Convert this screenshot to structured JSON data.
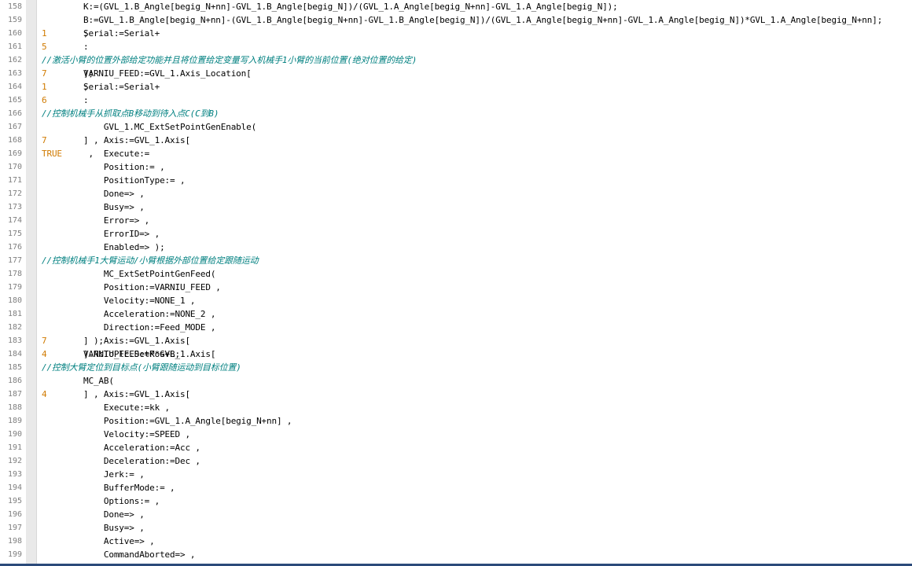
{
  "editor": {
    "lines": [
      {
        "n": "158",
        "segs": [
          {
            "t": "K:=(GVL_1.B_Angle[begig_N+nn]-GVL_1.B_Angle[begig_N])/(GVL_1.A_Angle[begig_N+nn]-GVL_1.A_Angle[begig_N]);",
            "k": "code"
          }
        ]
      },
      {
        "n": "159",
        "segs": [
          {
            "t": "B:=GVL_1.B_Angle[begig_N+nn]-(GVL_1.B_Angle[begig_N+nn]-GVL_1.B_Angle[begig_N])/(GVL_1.A_Angle[begig_N+nn]-GVL_1.A_Angle[begig_N])*GVL_1.A_Angle[begig_N+nn];",
            "k": "code"
          }
        ]
      },
      {
        "n": "160",
        "segs": [
          {
            "t": "Serial:=Serial+",
            "k": "code"
          },
          {
            "t": "1",
            "k": "num"
          },
          {
            "t": ";",
            "k": "code"
          }
        ]
      },
      {
        "n": "161",
        "segs": [
          {
            "t": "5",
            "k": "num"
          },
          {
            "t": ":",
            "k": "code"
          }
        ]
      },
      {
        "n": "162",
        "segs": [
          {
            "t": "//激活小臂的位置外部给定功能并且将位置给定变量写入机械手1小臂的当前位置(绝对位置的给定)",
            "k": "cmt"
          }
        ]
      },
      {
        "n": "163",
        "segs": [
          {
            "t": "VARNIU_FEED:=GVL_1.Axis_Location[",
            "k": "code"
          },
          {
            "t": "7",
            "k": "num"
          },
          {
            "t": "];",
            "k": "code"
          }
        ]
      },
      {
        "n": "164",
        "segs": [
          {
            "t": "Serial:=Serial+",
            "k": "code"
          },
          {
            "t": "1",
            "k": "num"
          },
          {
            "t": ";",
            "k": "code"
          }
        ]
      },
      {
        "n": "165",
        "segs": [
          {
            "t": "    ",
            "k": "code"
          },
          {
            "t": "6",
            "k": "num"
          },
          {
            "t": ":",
            "k": "code"
          }
        ]
      },
      {
        "n": "166",
        "segs": [
          {
            "t": "    ",
            "k": "code"
          },
          {
            "t": "//控制机械手从抓取点B移动到待入点C(C到B)",
            "k": "cmt"
          }
        ]
      },
      {
        "n": "167",
        "segs": [
          {
            "t": "    GVL_1.MC_ExtSetPointGenEnable(",
            "k": "code"
          }
        ]
      },
      {
        "n": "168",
        "segs": [
          {
            "t": "    Axis:=GVL_1.Axis[",
            "k": "code"
          },
          {
            "t": "7",
            "k": "num"
          },
          {
            "t": "] ,",
            "k": "code"
          }
        ]
      },
      {
        "n": "169",
        "segs": [
          {
            "t": "    Execute:=",
            "k": "code"
          },
          {
            "t": "TRUE",
            "k": "num"
          },
          {
            "t": " ,",
            "k": "code"
          }
        ]
      },
      {
        "n": "170",
        "segs": [
          {
            "t": "    Position:= ,",
            "k": "code"
          }
        ]
      },
      {
        "n": "171",
        "segs": [
          {
            "t": "    PositionType:= ,",
            "k": "code"
          }
        ]
      },
      {
        "n": "172",
        "segs": [
          {
            "t": "    Done=> ,",
            "k": "code"
          }
        ]
      },
      {
        "n": "173",
        "segs": [
          {
            "t": "    Busy=> ,",
            "k": "code"
          }
        ]
      },
      {
        "n": "174",
        "segs": [
          {
            "t": "    Error=> ,",
            "k": "code"
          }
        ]
      },
      {
        "n": "175",
        "segs": [
          {
            "t": "    ErrorID=> ,",
            "k": "code"
          }
        ]
      },
      {
        "n": "176",
        "segs": [
          {
            "t": "    Enabled=> );",
            "k": "code"
          }
        ]
      },
      {
        "n": "177",
        "segs": [
          {
            "t": "    ",
            "k": "code"
          },
          {
            "t": "//控制机械手1大臂运动/小臂根据外部位置给定跟随运动",
            "k": "cmt"
          }
        ]
      },
      {
        "n": "178",
        "segs": [
          {
            "t": "    MC_ExtSetPointGenFeed(",
            "k": "code"
          }
        ]
      },
      {
        "n": "179",
        "segs": [
          {
            "t": "    Position:=VARNIU_FEED ,",
            "k": "code"
          }
        ]
      },
      {
        "n": "180",
        "segs": [
          {
            "t": "    Velocity:=NONE_1 ,",
            "k": "code"
          }
        ]
      },
      {
        "n": "181",
        "segs": [
          {
            "t": "    Acceleration:=NONE_2 ,",
            "k": "code"
          }
        ]
      },
      {
        "n": "182",
        "segs": [
          {
            "t": "    Direction:=Feed_MODE ,",
            "k": "code"
          }
        ]
      },
      {
        "n": "183",
        "segs": [
          {
            "t": "    Axis:=GVL_1.Axis[",
            "k": "code"
          },
          {
            "t": "7",
            "k": "num"
          },
          {
            "t": "] );",
            "k": "code"
          }
        ]
      },
      {
        "n": "184",
        "segs": [
          {
            "t": "VARNIU_FEED:=K*GVL_1.Axis[",
            "k": "code"
          },
          {
            "t": "4",
            "k": "num"
          },
          {
            "t": "].NcToPlc.SetPos+B;",
            "k": "code"
          }
        ]
      },
      {
        "n": "185",
        "segs": [
          {
            "t": "//控制大臂定位到目标点(小臂跟随运动到目标位置)",
            "k": "cmt"
          }
        ]
      },
      {
        "n": "186",
        "segs": [
          {
            "t": "MC_AB(",
            "k": "code"
          }
        ]
      },
      {
        "n": "187",
        "segs": [
          {
            "t": "    Axis:=GVL_1.Axis[",
            "k": "code"
          },
          {
            "t": "4",
            "k": "num"
          },
          {
            "t": "] ,",
            "k": "code"
          }
        ]
      },
      {
        "n": "188",
        "segs": [
          {
            "t": "    Execute:=kk ,",
            "k": "code"
          }
        ]
      },
      {
        "n": "189",
        "segs": [
          {
            "t": "    Position:=GVL_1.A_Angle[begig_N+nn] ,",
            "k": "code"
          }
        ]
      },
      {
        "n": "190",
        "segs": [
          {
            "t": "    Velocity:=SPEED ,",
            "k": "code"
          }
        ]
      },
      {
        "n": "191",
        "segs": [
          {
            "t": "    Acceleration:=Acc ,",
            "k": "code"
          }
        ]
      },
      {
        "n": "192",
        "segs": [
          {
            "t": "    Deceleration:=Dec ,",
            "k": "code"
          }
        ]
      },
      {
        "n": "193",
        "segs": [
          {
            "t": "    Jerk:= ,",
            "k": "code"
          }
        ]
      },
      {
        "n": "194",
        "segs": [
          {
            "t": "    BufferMode:= ,",
            "k": "code"
          }
        ]
      },
      {
        "n": "195",
        "segs": [
          {
            "t": "    Options:= ,",
            "k": "code"
          }
        ]
      },
      {
        "n": "196",
        "segs": [
          {
            "t": "    Done=> ,",
            "k": "code"
          }
        ]
      },
      {
        "n": "197",
        "segs": [
          {
            "t": "    Busy=> ,",
            "k": "code"
          }
        ]
      },
      {
        "n": "198",
        "segs": [
          {
            "t": "    Active=> ,",
            "k": "code"
          }
        ]
      },
      {
        "n": "199",
        "segs": [
          {
            "t": "    CommandAborted=> ,",
            "k": "code"
          }
        ]
      }
    ]
  }
}
